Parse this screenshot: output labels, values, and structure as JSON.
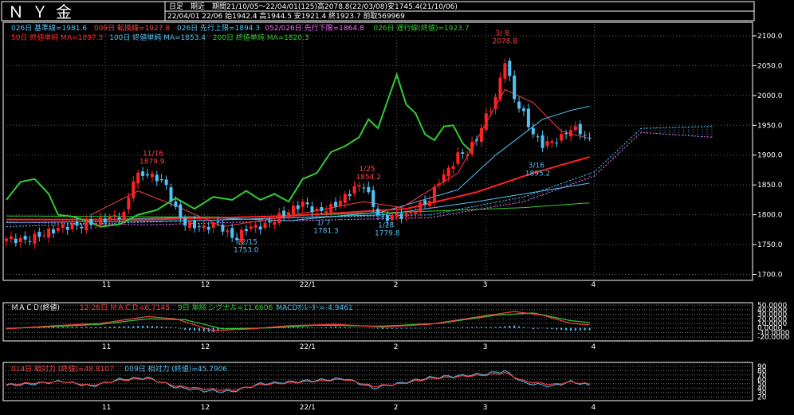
{
  "header": {
    "title": "ＮＹ金",
    "period_label": "日足　期近",
    "range_info": "期間21/10/05～22/04/01(125)高2078.8(22/03/08)安1745.4(21/10/06)",
    "last_bar_info": "22/04/01 22/06 始1942.4 高1944.5 安1921.4 終1923.7 前取569969"
  },
  "legend": {
    "row1": [
      {
        "text": "026日 基準線=1981.6",
        "color": "#4fc3f7"
      },
      {
        "text": "009日 転換線=1927.8",
        "color": "#ff4040"
      },
      {
        "text": "026日 先行上限=1894.3",
        "color": "#4fc3f7"
      },
      {
        "text": "052/026日 先行下限=1864.8",
        "color": "#ff66ff"
      },
      {
        "text": "026日 遅行線(終値)=1923.7",
        "color": "#33cc33"
      }
    ],
    "row2": [
      {
        "text": "50日 終値単純 MA=1897.3",
        "color": "#ff2222"
      },
      {
        "text": "100日 終値単純 MA=1853.4",
        "color": "#4fc3f7"
      },
      {
        "text": "200日 終値単純 MA=1820.3",
        "color": "#33cc33"
      }
    ]
  },
  "macd_panel": {
    "label": "ＭＡＣＤ(終値)",
    "legend": [
      {
        "text": "12-26日 ＭＡＣＤ=6.7145",
        "color": "#ff4040"
      },
      {
        "text": "9日 単純 シグナル=11.6606",
        "color": "#33cc33"
      },
      {
        "text": "MACDｵｼﾚｰﾀｰ=-4.9461",
        "color": "#4fc3f7"
      }
    ],
    "y_ticks": [
      "50.0000",
      "40.0000",
      "30.0000",
      "20.0000",
      "10.0000",
      "0.0000",
      "-10.0000",
      "-20.0000"
    ]
  },
  "rsi_panel": {
    "legend": [
      {
        "text": "014日 相対力 (終値)=48.8107",
        "color": "#ff4040"
      },
      {
        "text": "009日 相対力 (終値)=45.7906",
        "color": "#4fc3f7"
      }
    ],
    "y_ticks": [
      "90",
      "80",
      "70",
      "60",
      "50",
      "40",
      "30",
      "20"
    ]
  },
  "annotations": [
    {
      "date": "11/16",
      "value": "1879.9",
      "color": "#ff4040"
    },
    {
      "date": "12/15",
      "value": "1753.0",
      "color": "#4fc3f7"
    },
    {
      "date": "1/ 7",
      "value": "1781.3",
      "color": "#4fc3f7"
    },
    {
      "date": "1/25",
      "value": "1854.2",
      "color": "#ff4040"
    },
    {
      "date": "1/28",
      "value": "1779.8",
      "color": "#4fc3f7"
    },
    {
      "date": "3/ 8",
      "value": "2078.8",
      "color": "#ff4040"
    },
    {
      "date": "3/16",
      "value": "1895.2",
      "color": "#4fc3f7"
    }
  ],
  "x_labels": [
    "11",
    "12",
    "22/1",
    "2",
    "3",
    "4"
  ],
  "chart_data": {
    "type": "candlestick",
    "y_ticks": [
      "2100.0",
      "2050.0",
      "2000.0",
      "1950.0",
      "1900.0",
      "1850.0",
      "1800.0",
      "1750.0",
      "1700.0"
    ],
    "ylim": [
      1690,
      2120
    ],
    "x_month_ticks": [
      {
        "label": "11",
        "bar": 21
      },
      {
        "label": "12",
        "bar": 42
      },
      {
        "label": "22/1",
        "bar": 63
      },
      {
        "label": "2",
        "bar": 83
      },
      {
        "label": "3",
        "bar": 102
      },
      {
        "label": "4",
        "bar": 125
      }
    ],
    "bar_count": 125,
    "highlights": [
      {
        "label": "high",
        "date": "22/03/08",
        "value": 2078.8
      },
      {
        "label": "low",
        "date": "21/10/06",
        "value": 1745.4
      }
    ],
    "close_keypoints": [
      [
        0,
        1760
      ],
      [
        4,
        1757
      ],
      [
        8,
        1768
      ],
      [
        12,
        1780
      ],
      [
        16,
        1782
      ],
      [
        20,
        1790
      ],
      [
        22,
        1795
      ],
      [
        25,
        1800
      ],
      [
        27,
        1860
      ],
      [
        29,
        1869
      ],
      [
        32,
        1862
      ],
      [
        34,
        1848
      ],
      [
        36,
        1808
      ],
      [
        38,
        1785
      ],
      [
        40,
        1782
      ],
      [
        42,
        1778
      ],
      [
        45,
        1786
      ],
      [
        47,
        1768
      ],
      [
        49,
        1760
      ],
      [
        51,
        1778
      ],
      [
        55,
        1782
      ],
      [
        58,
        1797
      ],
      [
        61,
        1810
      ],
      [
        63,
        1820
      ],
      [
        66,
        1805
      ],
      [
        69,
        1812
      ],
      [
        72,
        1830
      ],
      [
        74,
        1845
      ],
      [
        76,
        1850
      ],
      [
        78,
        1815
      ],
      [
        80,
        1790
      ],
      [
        82,
        1799
      ],
      [
        85,
        1799
      ],
      [
        88,
        1815
      ],
      [
        90,
        1825
      ],
      [
        92,
        1858
      ],
      [
        94,
        1875
      ],
      [
        96,
        1900
      ],
      [
        98,
        1905
      ],
      [
        100,
        1928
      ],
      [
        102,
        1965
      ],
      [
        104,
        1995
      ],
      [
        106,
        2060
      ],
      [
        108,
        1995
      ],
      [
        110,
        1968
      ],
      [
        112,
        1935
      ],
      [
        114,
        1918
      ],
      [
        116,
        1922
      ],
      [
        118,
        1930
      ],
      [
        120,
        1945
      ],
      [
        122,
        1940
      ],
      [
        124,
        1924
      ]
    ],
    "ma50_keypoints": [
      [
        0,
        1792
      ],
      [
        30,
        1792
      ],
      [
        60,
        1798
      ],
      [
        85,
        1810
      ],
      [
        100,
        1838
      ],
      [
        112,
        1870
      ],
      [
        124,
        1897
      ]
    ],
    "ma100_keypoints": [
      [
        0,
        1787
      ],
      [
        40,
        1790
      ],
      [
        80,
        1800
      ],
      [
        100,
        1822
      ],
      [
        124,
        1853
      ]
    ],
    "ma200_keypoints": [
      [
        0,
        1798
      ],
      [
        50,
        1796
      ],
      [
        90,
        1806
      ],
      [
        110,
        1812
      ],
      [
        124,
        1820
      ]
    ],
    "chikou_keypoints": [
      [
        0,
        1825
      ],
      [
        3,
        1855
      ],
      [
        6,
        1860
      ],
      [
        9,
        1835
      ],
      [
        11,
        1800
      ],
      [
        14,
        1797
      ],
      [
        17,
        1790
      ],
      [
        20,
        1780
      ],
      [
        24,
        1784
      ],
      [
        28,
        1800
      ],
      [
        32,
        1808
      ],
      [
        36,
        1828
      ],
      [
        40,
        1810
      ],
      [
        44,
        1830
      ],
      [
        48,
        1825
      ],
      [
        51,
        1840
      ],
      [
        54,
        1825
      ],
      [
        57,
        1835
      ],
      [
        60,
        1822
      ],
      [
        63,
        1860
      ],
      [
        66,
        1870
      ],
      [
        69,
        1905
      ],
      [
        72,
        1915
      ],
      [
        75,
        1930
      ],
      [
        77,
        1960
      ],
      [
        79,
        1945
      ],
      [
        81,
        1990
      ],
      [
        83,
        2035
      ],
      [
        85,
        1985
      ],
      [
        87,
        1970
      ],
      [
        89,
        1935
      ],
      [
        91,
        1925
      ],
      [
        93,
        1948
      ],
      [
        95,
        1950
      ],
      [
        97,
        1920
      ],
      [
        99,
        1905
      ]
    ],
    "tenkan_keypoints": [
      [
        18,
        1800
      ],
      [
        28,
        1840
      ],
      [
        36,
        1815
      ],
      [
        46,
        1780
      ],
      [
        60,
        1798
      ],
      [
        76,
        1822
      ],
      [
        84,
        1812
      ],
      [
        96,
        1870
      ],
      [
        106,
        2010
      ],
      [
        112,
        1988
      ],
      [
        118,
        1940
      ],
      [
        124,
        1928
      ]
    ],
    "kijun_keypoints": [
      [
        20,
        1792
      ],
      [
        40,
        1796
      ],
      [
        60,
        1790
      ],
      [
        80,
        1805
      ],
      [
        96,
        1842
      ],
      [
        104,
        1900
      ],
      [
        114,
        1960
      ],
      [
        120,
        1975
      ],
      [
        124,
        1982
      ]
    ],
    "span_a_keypoints": [
      [
        0,
        1780
      ],
      [
        30,
        1788
      ],
      [
        60,
        1795
      ],
      [
        90,
        1800
      ],
      [
        110,
        1830
      ],
      [
        125,
        1872
      ],
      [
        135,
        1945
      ],
      [
        150,
        1948
      ]
    ],
    "span_b_keypoints": [
      [
        0,
        1788
      ],
      [
        30,
        1783
      ],
      [
        60,
        1790
      ],
      [
        90,
        1795
      ],
      [
        110,
        1822
      ],
      [
        125,
        1865
      ],
      [
        135,
        1938
      ],
      [
        150,
        1930
      ]
    ],
    "macd": {
      "ylim": [
        -25,
        52
      ],
      "macd_keypoints": [
        [
          0,
          -2
        ],
        [
          10,
          5
        ],
        [
          20,
          10
        ],
        [
          30,
          25
        ],
        [
          36,
          20
        ],
        [
          44,
          -6
        ],
        [
          52,
          -2
        ],
        [
          60,
          5
        ],
        [
          70,
          8
        ],
        [
          80,
          2
        ],
        [
          90,
          8
        ],
        [
          100,
          24
        ],
        [
          108,
          36
        ],
        [
          114,
          28
        ],
        [
          120,
          10
        ],
        [
          124,
          7
        ]
      ],
      "signal_keypoints": [
        [
          0,
          -1
        ],
        [
          10,
          3
        ],
        [
          20,
          8
        ],
        [
          30,
          20
        ],
        [
          38,
          18
        ],
        [
          46,
          -2
        ],
        [
          56,
          0
        ],
        [
          66,
          6
        ],
        [
          80,
          4
        ],
        [
          92,
          10
        ],
        [
          104,
          28
        ],
        [
          112,
          33
        ],
        [
          120,
          16
        ],
        [
          124,
          12
        ]
      ]
    },
    "rsi": {
      "ylim": [
        15,
        95
      ],
      "rsi14_keypoints": [
        [
          0,
          48
        ],
        [
          6,
          52
        ],
        [
          12,
          55
        ],
        [
          18,
          46
        ],
        [
          24,
          58
        ],
        [
          30,
          62
        ],
        [
          36,
          45
        ],
        [
          42,
          38
        ],
        [
          48,
          35
        ],
        [
          54,
          48
        ],
        [
          60,
          52
        ],
        [
          66,
          56
        ],
        [
          72,
          60
        ],
        [
          78,
          44
        ],
        [
          84,
          50
        ],
        [
          90,
          62
        ],
        [
          96,
          66
        ],
        [
          102,
          70
        ],
        [
          106,
          75
        ],
        [
          110,
          56
        ],
        [
          116,
          48
        ],
        [
          120,
          54
        ],
        [
          124,
          49
        ]
      ],
      "rsi9_keypoints": [
        [
          0,
          46
        ],
        [
          6,
          50
        ],
        [
          12,
          56
        ],
        [
          18,
          44
        ],
        [
          24,
          60
        ],
        [
          30,
          64
        ],
        [
          36,
          42
        ],
        [
          42,
          34
        ],
        [
          48,
          32
        ],
        [
          54,
          50
        ],
        [
          60,
          54
        ],
        [
          66,
          58
        ],
        [
          72,
          62
        ],
        [
          78,
          40
        ],
        [
          84,
          52
        ],
        [
          90,
          64
        ],
        [
          96,
          68
        ],
        [
          102,
          73
        ],
        [
          106,
          79
        ],
        [
          110,
          52
        ],
        [
          116,
          44
        ],
        [
          120,
          55
        ],
        [
          124,
          46
        ]
      ]
    }
  }
}
